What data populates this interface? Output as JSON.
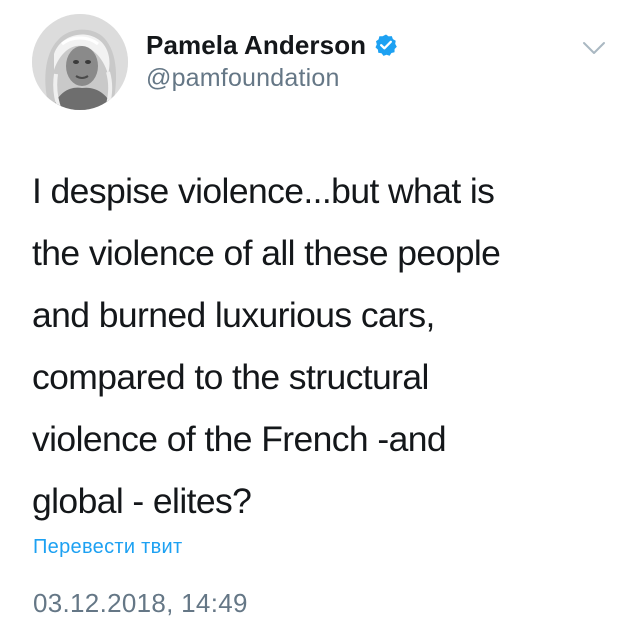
{
  "user": {
    "display_name": "Pamela Anderson",
    "handle": "@pamfoundation",
    "verified": true
  },
  "tweet": {
    "lines": [
      "I despise violence...but what is",
      "the violence of all these people",
      "and burned luxurious cars,",
      "compared to the structural",
      "violence of the French -and",
      "global - elites?"
    ],
    "translate_label": "Перевести твит",
    "timestamp": "03.12.2018, 14:49"
  },
  "icons": {
    "verified": "verified-badge-icon",
    "menu": "chevron-down-icon"
  },
  "colors": {
    "text": "#14171a",
    "secondary": "#657786",
    "accent": "#1da1f2"
  }
}
